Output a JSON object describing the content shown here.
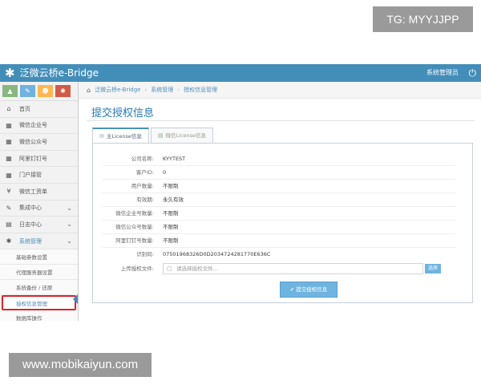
{
  "watermarks": {
    "top": "TG: MYYJJPP",
    "bottom": "www.mobikaiyun.com"
  },
  "topbar": {
    "app_title": "泛微云桥e-Bridge",
    "user": "系统管理员"
  },
  "shortcuts": [
    {
      "icon": "signal-icon",
      "glyph": "▲"
    },
    {
      "icon": "pencil-icon",
      "glyph": "✎"
    },
    {
      "icon": "group-icon",
      "glyph": "☻"
    },
    {
      "icon": "cog-icon",
      "glyph": "✱"
    }
  ],
  "sidebar": {
    "items": [
      {
        "label": "首页",
        "icon": "home-icon",
        "glyph": "⌂"
      },
      {
        "label": "微信企业号",
        "icon": "grid-icon",
        "glyph": "▦"
      },
      {
        "label": "微信公众号",
        "icon": "grid-icon",
        "glyph": "▦"
      },
      {
        "label": "阿里钉钉号",
        "icon": "grid-icon",
        "glyph": "▦"
      },
      {
        "label": "门户接管",
        "icon": "grid-icon",
        "glyph": "▦"
      },
      {
        "label": "微信工资单",
        "icon": "yen-icon",
        "glyph": "¥"
      },
      {
        "label": "集成中心",
        "icon": "link-icon",
        "glyph": "✎",
        "chevron": "⌄"
      },
      {
        "label": "日志中心",
        "icon": "calendar-icon",
        "glyph": "▤",
        "chevron": "⌄"
      },
      {
        "label": "系统管理",
        "icon": "cog-icon",
        "glyph": "✱",
        "chevron": "⌄"
      }
    ],
    "subitems": [
      {
        "label": "基础参数设置"
      },
      {
        "label": "代理服务器设置"
      },
      {
        "label": "系统备份 / 还原"
      },
      {
        "label": "授权信息管理"
      },
      {
        "label": "数据库操作"
      }
    ]
  },
  "breadcrumb": [
    "泛微云桥e-Bridge",
    "系统管理",
    "授权信息管理"
  ],
  "page": {
    "title": "提交授权信息"
  },
  "tabs": [
    {
      "label": "主License信息",
      "active": true
    },
    {
      "label": "微信License信息",
      "active": false
    }
  ],
  "fields": [
    {
      "label": "公司名称:",
      "value": "KYYTEST"
    },
    {
      "label": "客户ID:",
      "value": "0"
    },
    {
      "label": "用户数量:",
      "value": "不限制"
    },
    {
      "label": "有效期:",
      "value": "永久有效"
    },
    {
      "label": "微信企业号数量:",
      "value": "不限制"
    },
    {
      "label": "微信公众号数量:",
      "value": "不限制"
    },
    {
      "label": "阿里钉钉号数量:",
      "value": "不限制"
    },
    {
      "label": "识别码:",
      "value": "07501968326D0D2034724281770E636C"
    }
  ],
  "upload": {
    "label": "上传授权文件:",
    "placeholder": "请选择授权文件...",
    "browse": "选择"
  },
  "submit_label": "✔ 提交授权信息"
}
